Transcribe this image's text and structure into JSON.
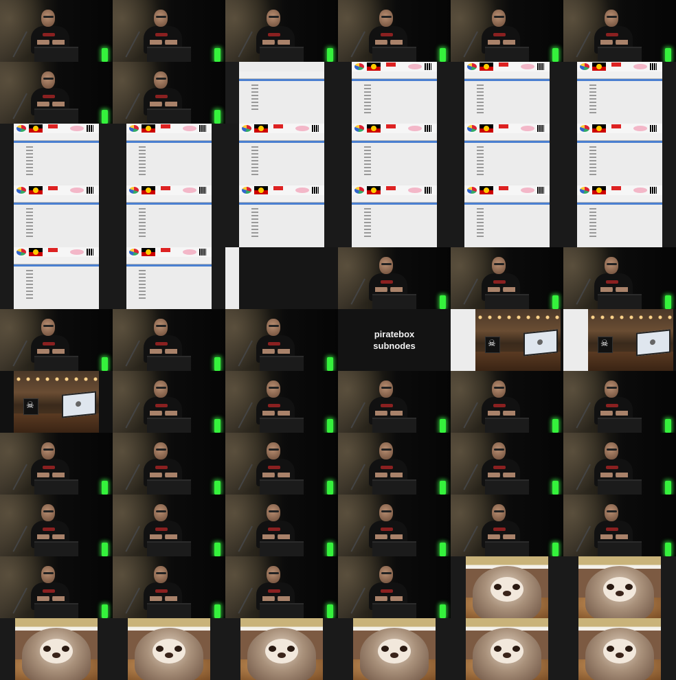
{
  "contact_sheet": {
    "columns": 6,
    "rows": 11,
    "tiles": [
      "speaker",
      "speaker",
      "speaker",
      "speaker",
      "speaker",
      "speaker",
      "speaker",
      "speaker",
      "screen-gap",
      "screen",
      "screen",
      "screen",
      "screen",
      "screen",
      "screen",
      "screen",
      "screen",
      "screen",
      "screen",
      "screen",
      "screen",
      "screen",
      "screen",
      "screen",
      "screen",
      "screen",
      "screen-half",
      "speaker",
      "speaker",
      "speaker",
      "speaker",
      "speaker",
      "speaker",
      "title",
      "cafe",
      "cafe",
      "cafe-left",
      "speaker",
      "speaker",
      "speaker",
      "speaker",
      "speaker",
      "speaker",
      "speaker",
      "speaker",
      "speaker",
      "speaker",
      "speaker",
      "speaker",
      "speaker",
      "speaker",
      "speaker",
      "speaker",
      "speaker",
      "speaker",
      "speaker",
      "speaker",
      "speaker",
      "sloth",
      "sloth",
      "sloth",
      "sloth",
      "sloth",
      "sloth",
      "sloth",
      "sloth"
    ]
  },
  "title_slide": {
    "line1": "piratebox",
    "line2": "subnodes"
  },
  "colors": {
    "background": "#121212",
    "led_green": "#35f23c",
    "ui_blue": "#4a7fd0"
  }
}
